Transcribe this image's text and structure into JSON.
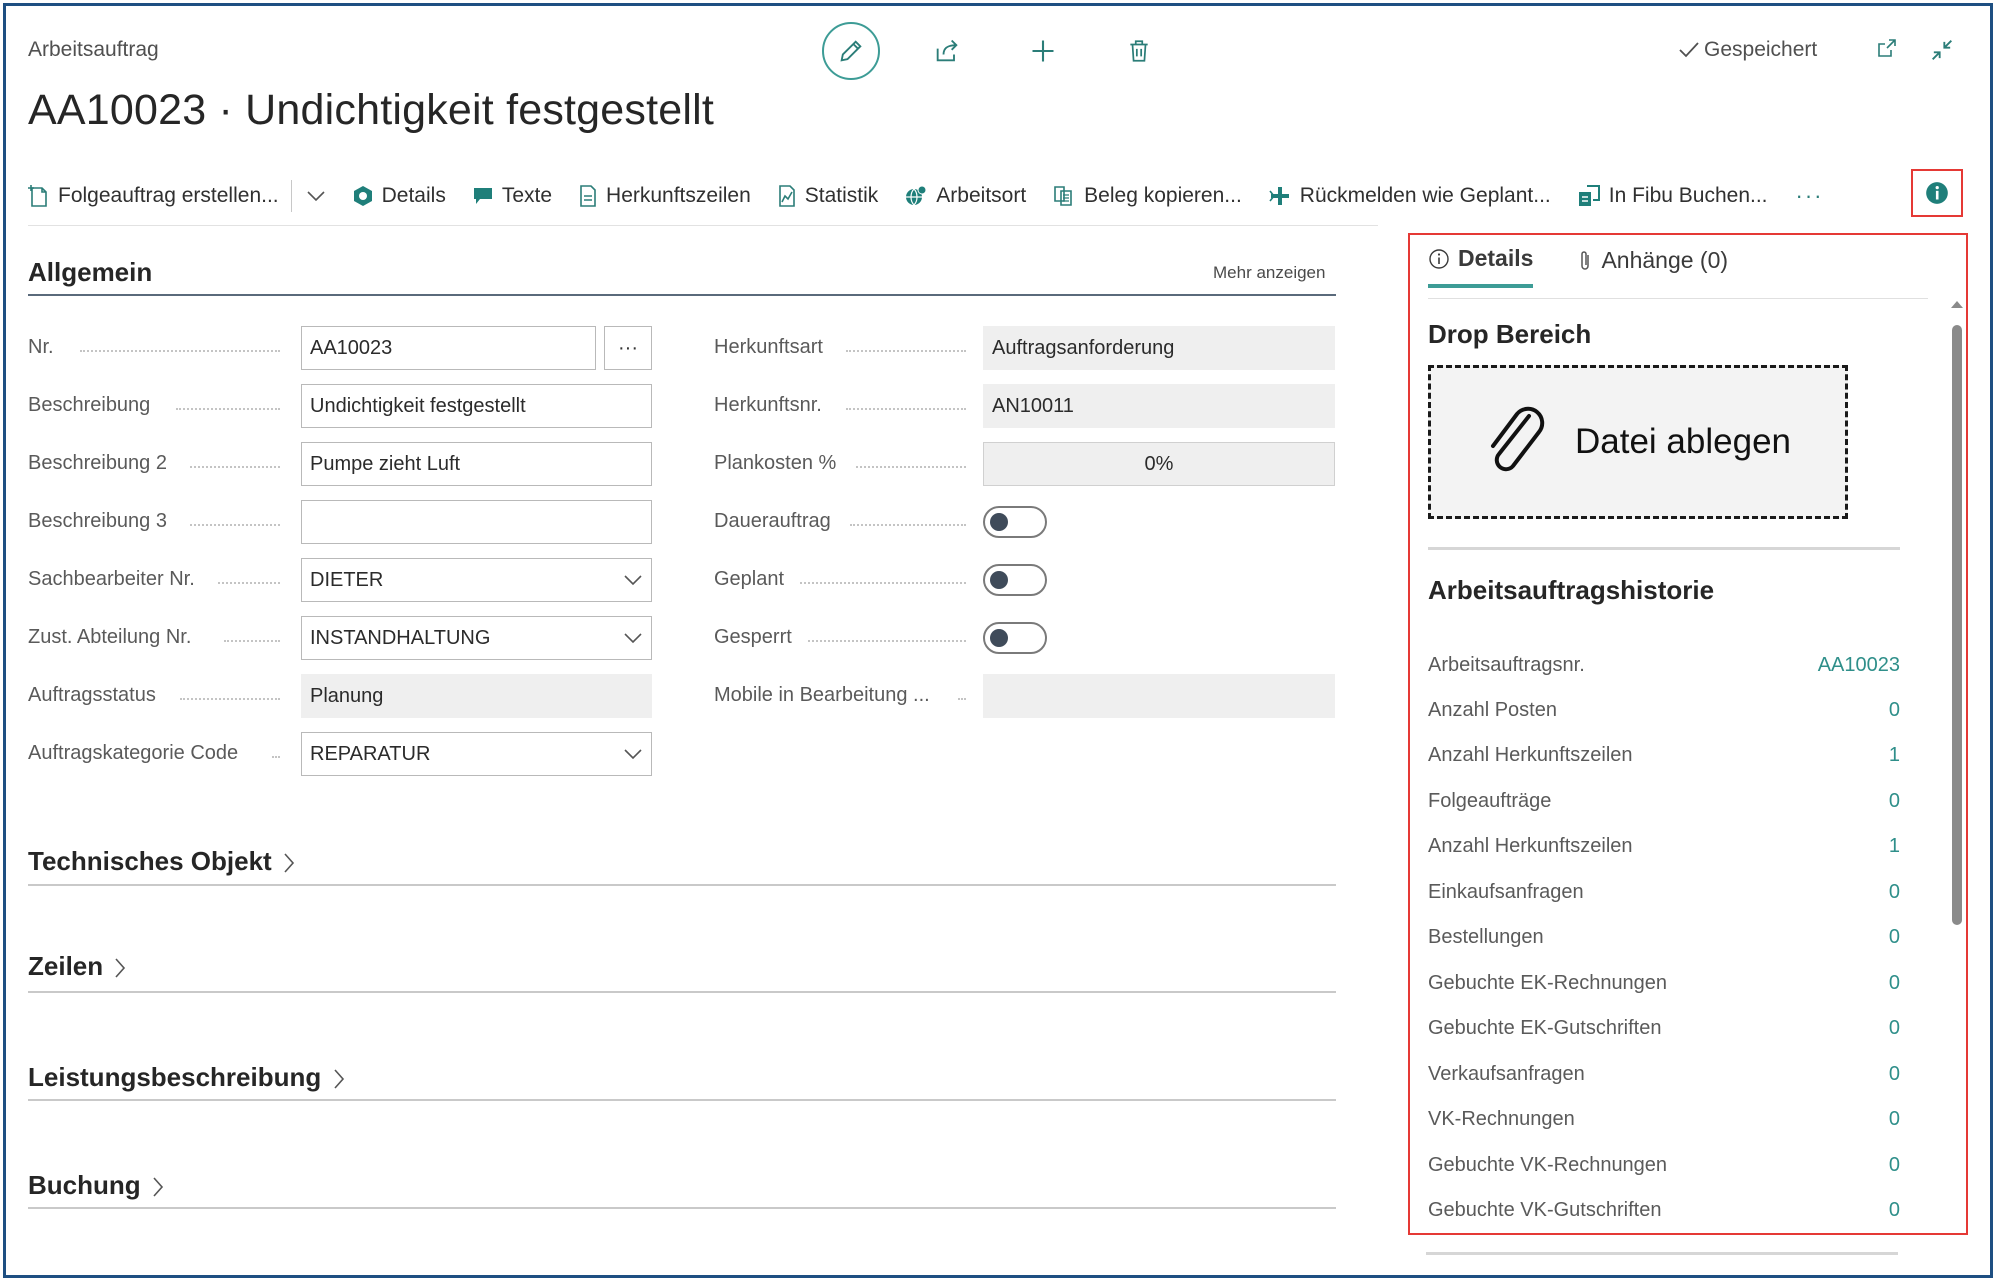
{
  "header": {
    "caption": "Arbeitsauftrag",
    "title": "AA10023 · Undichtigkeit festgestellt",
    "status": "Gespeichert"
  },
  "actions": {
    "folgeauftrag": "Folgeauftrag erstellen...",
    "details": "Details",
    "texte": "Texte",
    "herkunftszeilen": "Herkunftszeilen",
    "statistik": "Statistik",
    "arbeitsort": "Arbeitsort",
    "beleg": "Beleg kopieren...",
    "rueckmelden": "Rückmelden wie Geplant...",
    "fibu": "In Fibu Buchen...",
    "more": "···"
  },
  "general": {
    "title": "Allgemein",
    "more_link": "Mehr anzeigen",
    "nr_label": "Nr.",
    "nr_value": "AA10023",
    "nr_button": "···",
    "beschreibung_label": "Beschreibung",
    "beschreibung_value": "Undichtigkeit festgestellt",
    "beschreibung2_label": "Beschreibung 2",
    "beschreibung2_value": "Pumpe zieht Luft",
    "beschreibung3_label": "Beschreibung 3",
    "beschreibung3_value": "",
    "sachbearbeiter_label": "Sachbearbeiter Nr.",
    "sachbearbeiter_value": "DIETER",
    "abteilung_label": "Zust. Abteilung Nr.",
    "abteilung_value": "INSTANDHALTUNG",
    "status_label": "Auftragsstatus",
    "status_value": "Planung",
    "kategorie_label": "Auftragskategorie Code",
    "kategorie_value": "REPARATUR",
    "herkunftsart_label": "Herkunftsart",
    "herkunftsart_value": "Auftragsanforderung",
    "herkunftsnr_label": "Herkunftsnr.",
    "herkunftsnr_value": "AN10011",
    "plankosten_label": "Plankosten %",
    "plankosten_value": "0%",
    "dauerauftrag_label": "Dauerauftrag",
    "dauerauftrag_on": false,
    "geplant_label": "Geplant",
    "geplant_on": false,
    "gesperrt_label": "Gesperrt",
    "gesperrt_on": false,
    "mobile_label": "Mobile in Bearbeitung ...",
    "mobile_value": ""
  },
  "sections": {
    "technisches_objekt": "Technisches Objekt",
    "zeilen": "Zeilen",
    "leistungsbeschreibung": "Leistungsbeschreibung",
    "buchung": "Buchung"
  },
  "panel": {
    "tab_details": "Details",
    "tab_anhaenge": "Anhänge (0)",
    "drop_title": "Drop Bereich",
    "drop_text": "Datei ablegen",
    "history_title": "Arbeitsauftragshistorie",
    "history": [
      {
        "label": "Arbeitsauftragsnr.",
        "value": "AA10023"
      },
      {
        "label": "Anzahl Posten",
        "value": "0"
      },
      {
        "label": "Anzahl Herkunftszeilen",
        "value": "1"
      },
      {
        "label": "Folgeaufträge",
        "value": "0"
      },
      {
        "label": "Anzahl Herkunftszeilen",
        "value": "1"
      },
      {
        "label": "Einkaufsanfragen",
        "value": "0"
      },
      {
        "label": "Bestellungen",
        "value": "0"
      },
      {
        "label": "Gebuchte EK-Rechnungen",
        "value": "0"
      },
      {
        "label": "Gebuchte EK-Gutschriften",
        "value": "0"
      },
      {
        "label": "Verkaufsanfragen",
        "value": "0"
      },
      {
        "label": "VK-Rechnungen",
        "value": "0"
      },
      {
        "label": "Gebuchte VK-Rechnungen",
        "value": "0"
      },
      {
        "label": "Gebuchte VK-Gutschriften",
        "value": "0"
      }
    ]
  },
  "colors": {
    "accent": "#2f8f8a",
    "highlight_border": "#e53935",
    "frame": "#1e4f82"
  }
}
